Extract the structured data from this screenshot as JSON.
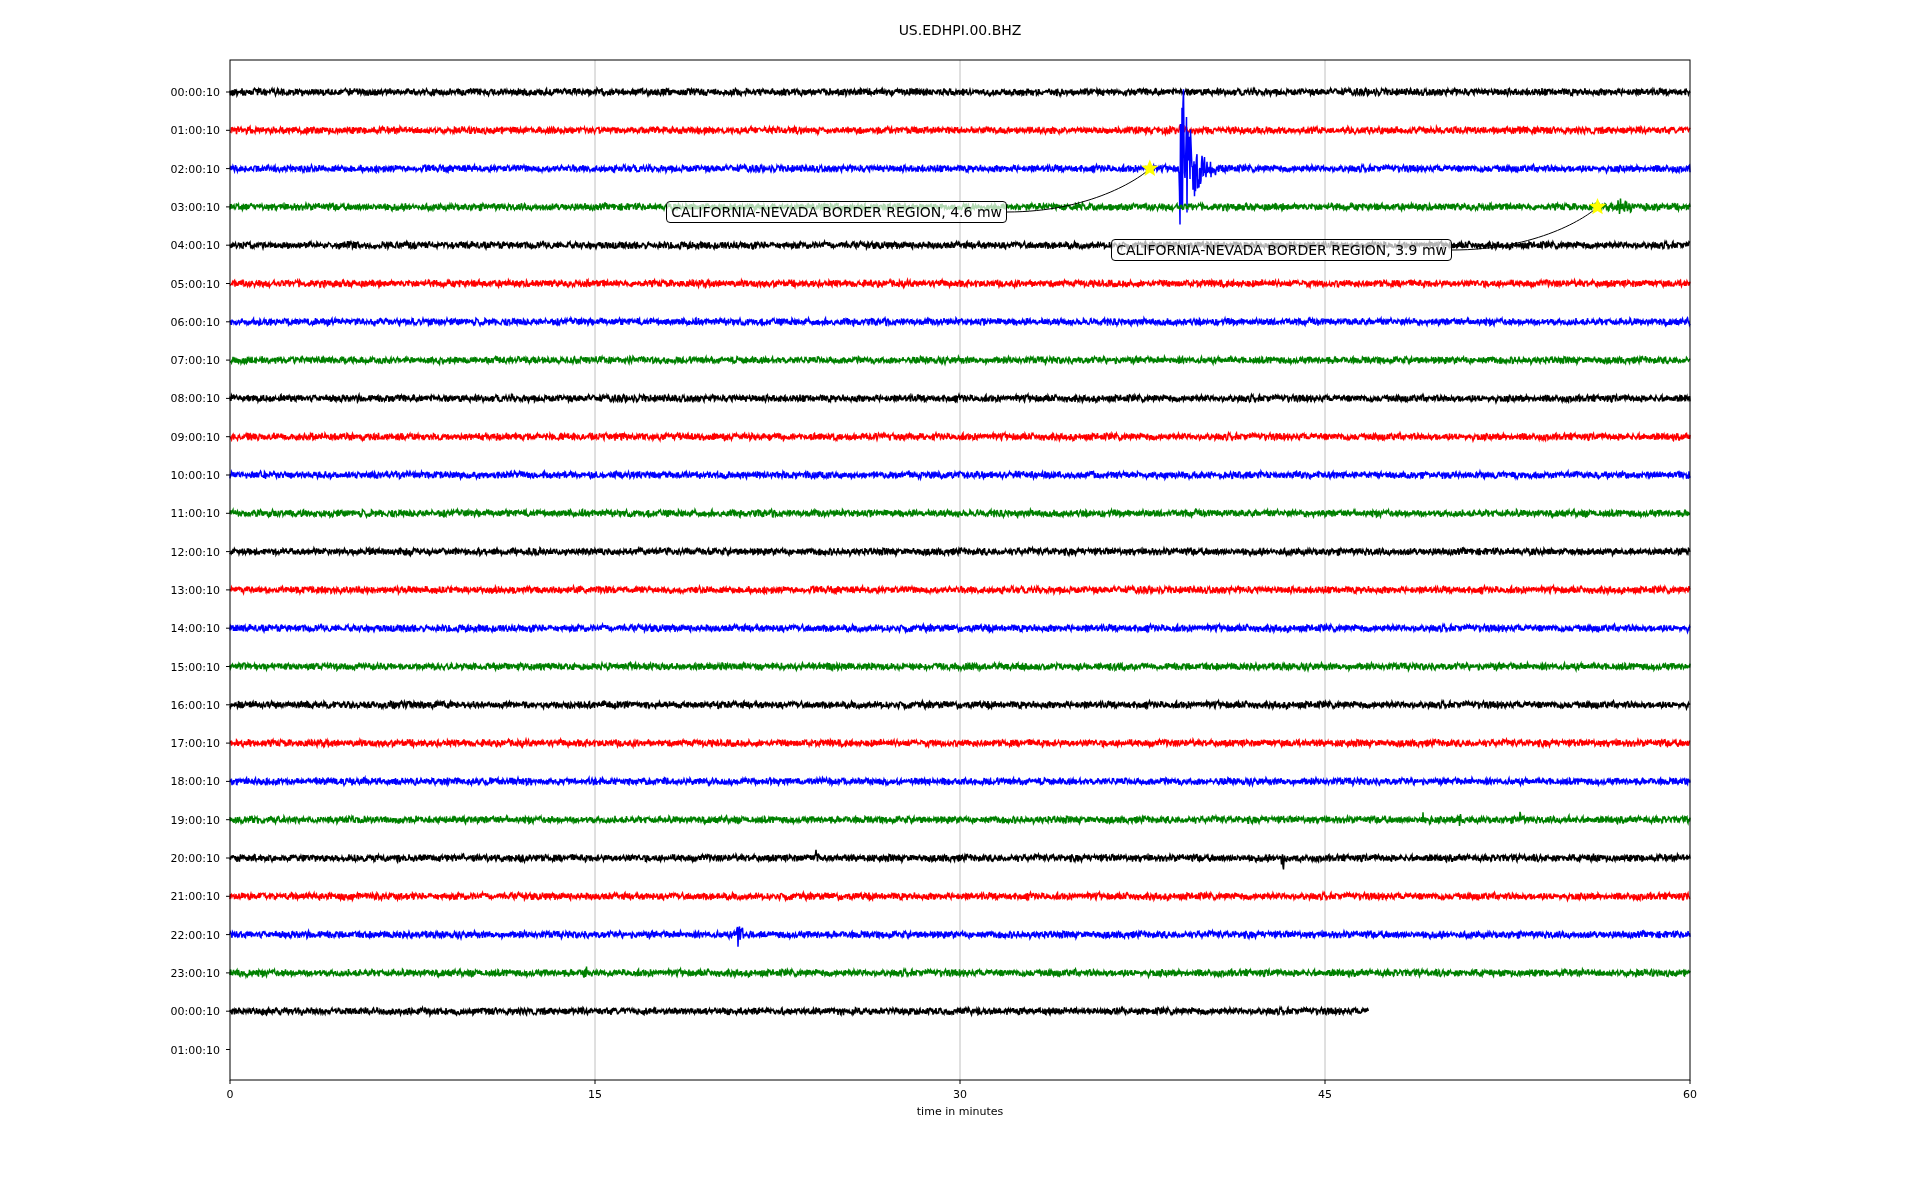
{
  "title": "US.EDHPI.00.BHZ",
  "xlabel": "time in minutes",
  "xticks": [
    "0",
    "15",
    "30",
    "45",
    "60"
  ],
  "traces": [
    {
      "label": "00:00:10",
      "color": "#000000"
    },
    {
      "label": "01:00:10",
      "color": "#ff0000"
    },
    {
      "label": "02:00:10",
      "color": "#0000ff",
      "annotation": "CALIFORNIA-NEVADA BORDER REGION, 4.6 mw"
    },
    {
      "label": "03:00:10",
      "color": "#008000",
      "annotation": "CALIFORNIA-NEVADA BORDER REGION, 3.9 mw"
    },
    {
      "label": "04:00:10",
      "color": "#000000"
    },
    {
      "label": "05:00:10",
      "color": "#ff0000"
    },
    {
      "label": "06:00:10",
      "color": "#0000ff"
    },
    {
      "label": "07:00:10",
      "color": "#008000"
    },
    {
      "label": "08:00:10",
      "color": "#000000"
    },
    {
      "label": "09:00:10",
      "color": "#ff0000"
    },
    {
      "label": "10:00:10",
      "color": "#0000ff"
    },
    {
      "label": "11:00:10",
      "color": "#008000"
    },
    {
      "label": "12:00:10",
      "color": "#000000"
    },
    {
      "label": "13:00:10",
      "color": "#ff0000"
    },
    {
      "label": "14:00:10",
      "color": "#0000ff"
    },
    {
      "label": "15:00:10",
      "color": "#008000"
    },
    {
      "label": "16:00:10",
      "color": "#000000"
    },
    {
      "label": "17:00:10",
      "color": "#ff0000"
    },
    {
      "label": "18:00:10",
      "color": "#0000ff"
    },
    {
      "label": "19:00:10",
      "color": "#008000"
    },
    {
      "label": "20:00:10",
      "color": "#000000"
    },
    {
      "label": "21:00:10",
      "color": "#ff0000"
    },
    {
      "label": "22:00:10",
      "color": "#0000ff"
    },
    {
      "label": "23:00:10",
      "color": "#008000"
    },
    {
      "label": "00:00:10",
      "color": "#000000",
      "level": 0.78
    },
    {
      "label": "01:00:10"
    }
  ]
}
